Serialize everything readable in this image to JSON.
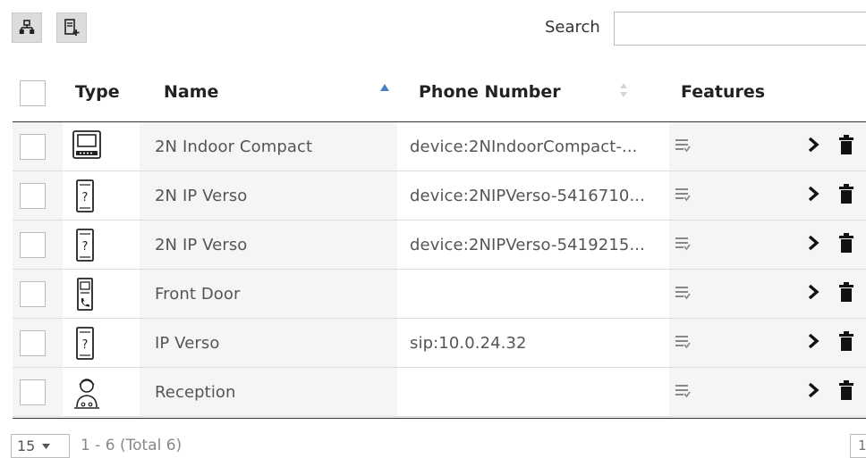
{
  "toolbar": {
    "tree_icon": "org-tree-icon",
    "add_icon": "add-device-icon",
    "search_label": "Search",
    "search_value": ""
  },
  "table": {
    "headers": {
      "type": "Type",
      "name": "Name",
      "phone": "Phone Number",
      "features": "Features"
    },
    "sort": {
      "column": "Name",
      "direction": "ascending"
    },
    "rows": [
      {
        "type_icon": "indoor-compact-icon",
        "name": "2N Indoor Compact",
        "phone": "device:2NIndoorCompact-..."
      },
      {
        "type_icon": "unknown-device-icon",
        "name": "2N IP Verso",
        "phone": "device:2NIPVerso-5416710..."
      },
      {
        "type_icon": "unknown-device-icon",
        "name": "2N IP Verso",
        "phone": "device:2NIPVerso-5419215..."
      },
      {
        "type_icon": "door-intercom-icon",
        "name": "Front Door",
        "phone": ""
      },
      {
        "type_icon": "unknown-device-icon",
        "name": "IP Verso",
        "phone": "sip:10.0.24.32"
      },
      {
        "type_icon": "receptionist-icon",
        "name": "Reception",
        "phone": ""
      }
    ]
  },
  "pager": {
    "page_size": "15",
    "info": "1 - 6 (Total 6)",
    "current_page": "1"
  }
}
